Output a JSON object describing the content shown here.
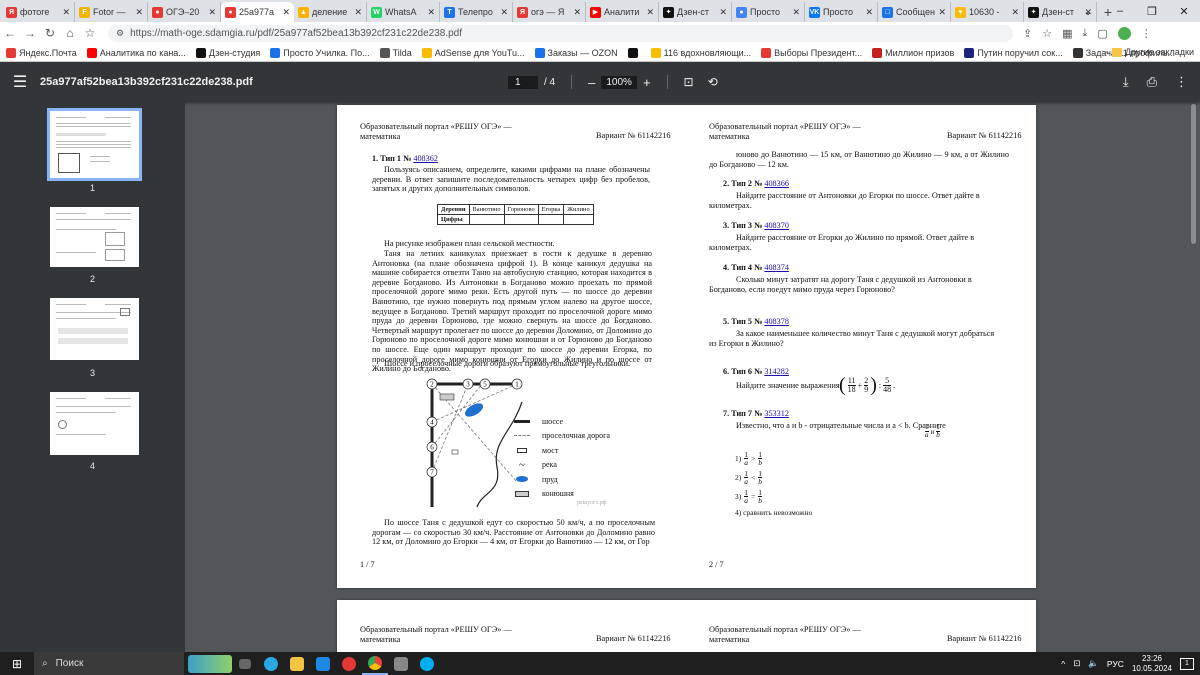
{
  "tabs": [
    {
      "title": "фотоге",
      "color": "#e53935",
      "glyph": "Я"
    },
    {
      "title": "Fotor —",
      "color": "#f4b400",
      "glyph": "F"
    },
    {
      "title": "ОГЭ–20",
      "color": "#e53935",
      "glyph": "●"
    },
    {
      "title": "25a977a",
      "color": "#e53935",
      "glyph": "●",
      "active": true
    },
    {
      "title": "деление",
      "color": "#ffb300",
      "glyph": "▲"
    },
    {
      "title": "WhatsA",
      "color": "#25d366",
      "glyph": "W"
    },
    {
      "title": "Телепро",
      "color": "#1a73e8",
      "glyph": "T"
    },
    {
      "title": "огэ — Я",
      "color": "#e53935",
      "glyph": "Я"
    },
    {
      "title": "Аналити",
      "color": "#ff0000",
      "glyph": "▶"
    },
    {
      "title": "Дзен-ст",
      "color": "#111111",
      "glyph": "✦"
    },
    {
      "title": "Просто",
      "color": "#4285f4",
      "glyph": "●"
    },
    {
      "title": "Просто",
      "color": "#0077ff",
      "glyph": "VK"
    },
    {
      "title": "Сообщен",
      "color": "#1a73e8",
      "glyph": "□"
    },
    {
      "title": "10630 -",
      "color": "#fbbc04",
      "glyph": "♥"
    },
    {
      "title": "Дзен-ст",
      "color": "#111111",
      "glyph": "✦"
    }
  ],
  "address": {
    "url": "https://math-oge.sdamgia.ru/pdf/25a977af52bea13b392cf231c22de238.pdf"
  },
  "bookmarks": [
    {
      "label": "Яндекс.Почта",
      "color": "#e53935"
    },
    {
      "label": "Аналитика по кана...",
      "color": "#ff0000"
    },
    {
      "label": "Дзен-студия",
      "color": "#111111"
    },
    {
      "label": "Просто Училка. По...",
      "color": "#1a73e8"
    },
    {
      "label": "Tilda",
      "color": "#555555"
    },
    {
      "label": "AdSense для YouTu...",
      "color": "#fbbc04"
    },
    {
      "label": "Заказы — OZON",
      "color": "#1a73e8"
    },
    {
      "label": "",
      "color": "#111111"
    },
    {
      "label": "116 вдохновляющи...",
      "color": "#fbbc04"
    },
    {
      "label": "Выборы Президент...",
      "color": "#e53935"
    },
    {
      "label": "Миллион призов",
      "color": "#c5221f"
    },
    {
      "label": "Путин поручил сок...",
      "color": "#1a237e"
    },
    {
      "label": "Задача 11 профиль...",
      "color": "#333333"
    }
  ],
  "bookmarks_other": "Другие закладки",
  "pdf": {
    "title": "25a977af52bea13b392cf231c22de238.pdf",
    "page_current": "1",
    "page_total": "/ 4",
    "zoom": "100%"
  },
  "thumbnails": [
    "1",
    "2",
    "3",
    "4"
  ],
  "page1": {
    "header_left_1": "Образовательный портал «РЕШУ ОГЭ» —",
    "header_left_2": "математика",
    "variant": "Вариант № 61142216",
    "task_head": "1.  Тип 1 № ",
    "task_link": "408362",
    "task_text": "Пользуясь описанием, определите, какими цифрами на плане обозначены деревни. В ответ запишите последовательность четырех цифр без пробелов, запятых и других дополнительных символов.",
    "table_headers": [
      "Деревни",
      "Ванютино",
      "Горюново",
      "Егорка",
      "Жилино"
    ],
    "table_row_label": "Цифры",
    "p1": "На рисунке изображен план сельской местности.",
    "p2": "Таня на летних каникулах приезжает в гости к дедушке в деревню Антоновка (на плане обозначена цифрой 1). В конце каникул дедушка на машине собирается отвезти Таню на автобусную станцию, которая находится в деревне Богданово. Из Антоновки в Богданово можно проехать по прямой проселочной дороге мимо реки. Есть другой путь — по шоссе до деревни Ванютино, где нужно повернуть под прямым углом налево на другое шоссе, ведущее в Богданово. Третий маршрут проходит по проселочной дороге мимо пруда до деревни Горюново, где можно свернуть на шоссе до Богданово. Четвертый маршрут пролегает по шоссе до деревни Доломино, от Доломино до Горюново по проселочной дороге мимо конюшни и от Горюново до Богданово по шоссе. Еще один маршрут проходит по шоссе до деревни Егорка, по проселочной дороге мимо конюшни от Егорки до Жилино и по шоссе от Жилино до Богданово.",
    "p3": "Шоссе и проселочные дороги образуют прямоугольные треугольники.",
    "legend": [
      "шоссе",
      "проселочная дорога",
      "мост",
      "река",
      "пруд",
      "конюшня"
    ],
    "watermark": "решуогэ.рф",
    "map_numbers": [
      "2",
      "3",
      "5",
      "1",
      "4",
      "6",
      "7"
    ],
    "p4": "По шоссе Таня с дедушкой едут со скоростью 50 км/ч, а по проселочным дорогам — со скоростью 30 км/ч. Расстояние от Антоновки до Доломино равно 12 км, от Доломино до Егорки — 4 км, от Егорки до Ванютино — 12 км, от Гор",
    "footer": "1 / 7"
  },
  "page2": {
    "header_left_1": "Образовательный портал «РЕШУ ОГЭ» —",
    "header_left_2": "математика",
    "variant": "Вариант № 61142216",
    "cont": "юново до Ванютино — 15 км, от Ванютино до Жилино — 9 км, а от Жилино до Богданово — 12 км.",
    "tasks": [
      {
        "head": "2.  Тип 2 № ",
        "link": "408366",
        "text": "Найдите расстояние от Антоновки до Егорки по шоссе. Ответ дайте в километрах."
      },
      {
        "head": "3.  Тип 3 № ",
        "link": "408370",
        "text": "Найдите расстояние от Егорки до Жилино по прямой. Ответ дайте в километрах."
      },
      {
        "head": "4.  Тип 4 № ",
        "link": "408374",
        "text": "Сколько минут затратят на дорогу Таня с дедушкой из Антоновки в Богданово, если поедут мимо пруда через Горюново?"
      },
      {
        "head": "5.  Тип 5 № ",
        "link": "408378",
        "text": "За какое наименьшее количество минут Таня с дедушкой могут добраться из Егорки в Жилино?"
      },
      {
        "head": "6.  Тип 6 № ",
        "link": "314282",
        "text": "Найдите значение выражения"
      },
      {
        "head": "7.  Тип 7 № ",
        "link": "353312",
        "text": "Известно, что a и b - отрицательные числа и a < b. Сравните"
      }
    ],
    "options": [
      "1)",
      "2)",
      "3)",
      "4)  сравнить невозможно"
    ],
    "footer": "2 / 7"
  },
  "page3": {
    "header_left_1": "Образовательный портал «РЕШУ ОГЭ» —",
    "header_left_2": "математика",
    "variant": "Вариант № 61142216"
  },
  "taskbar": {
    "search": "Поиск",
    "lang": "РУС",
    "time": "23:26",
    "date": "10.05.2024",
    "notif": "1"
  }
}
